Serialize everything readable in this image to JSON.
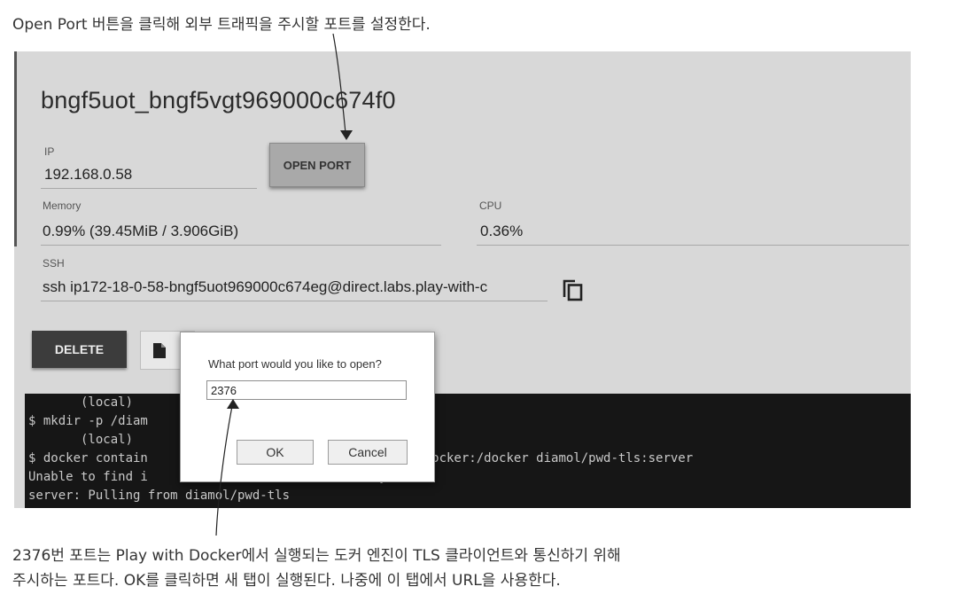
{
  "annotations": {
    "top": "Open Port 버튼을 클릭해 외부 트래픽을 주시할 포트를 설정한다.",
    "bottom_line1": "2376번 포트는 Play with Docker에서 실행되는 도커 엔진이 TLS 클라이언트와 통신하기 위해",
    "bottom_line2": "주시하는 포트다. OK를 클릭하면 새 탭이 실행된다. 나중에 이 탭에서 URL을 사용한다."
  },
  "instance": {
    "title": "bngf5uot_bngf5vgt969000c674f0",
    "ip_label": "IP",
    "ip_value": "192.168.0.58",
    "open_port_label": "OPEN PORT",
    "memory_label": "Memory",
    "memory_value": "0.99% (39.45MiB / 3.906GiB)",
    "cpu_label": "CPU",
    "cpu_value": "0.36%",
    "ssh_label": "SSH",
    "ssh_value": "ssh ip172-18-0-58-bngf5uot969000c674eg@direct.labs.play-with-c",
    "delete_label": "DELETE"
  },
  "terminal": {
    "lines": [
      "       (local)",
      "$ mkdir -p /diam",
      "       (local)",
      "$ docker contain                        erts -v /etc/docker:/docker diamol/pwd-tls:server",
      "Unable to find i                       ' locally",
      "server: Pulling from diamol/pwd-tls"
    ]
  },
  "dialog": {
    "message": "What port would you like to open?",
    "input_value": "2376",
    "ok_label": "OK",
    "cancel_label": "Cancel"
  },
  "icons": {
    "copy": "copy-icon",
    "file": "file-icon"
  },
  "colors": {
    "panel_bg": "#d8d8d8",
    "terminal_bg": "#161616",
    "delete_bg": "#3c3c3c",
    "open_port_bg": "#a9a9a9"
  }
}
